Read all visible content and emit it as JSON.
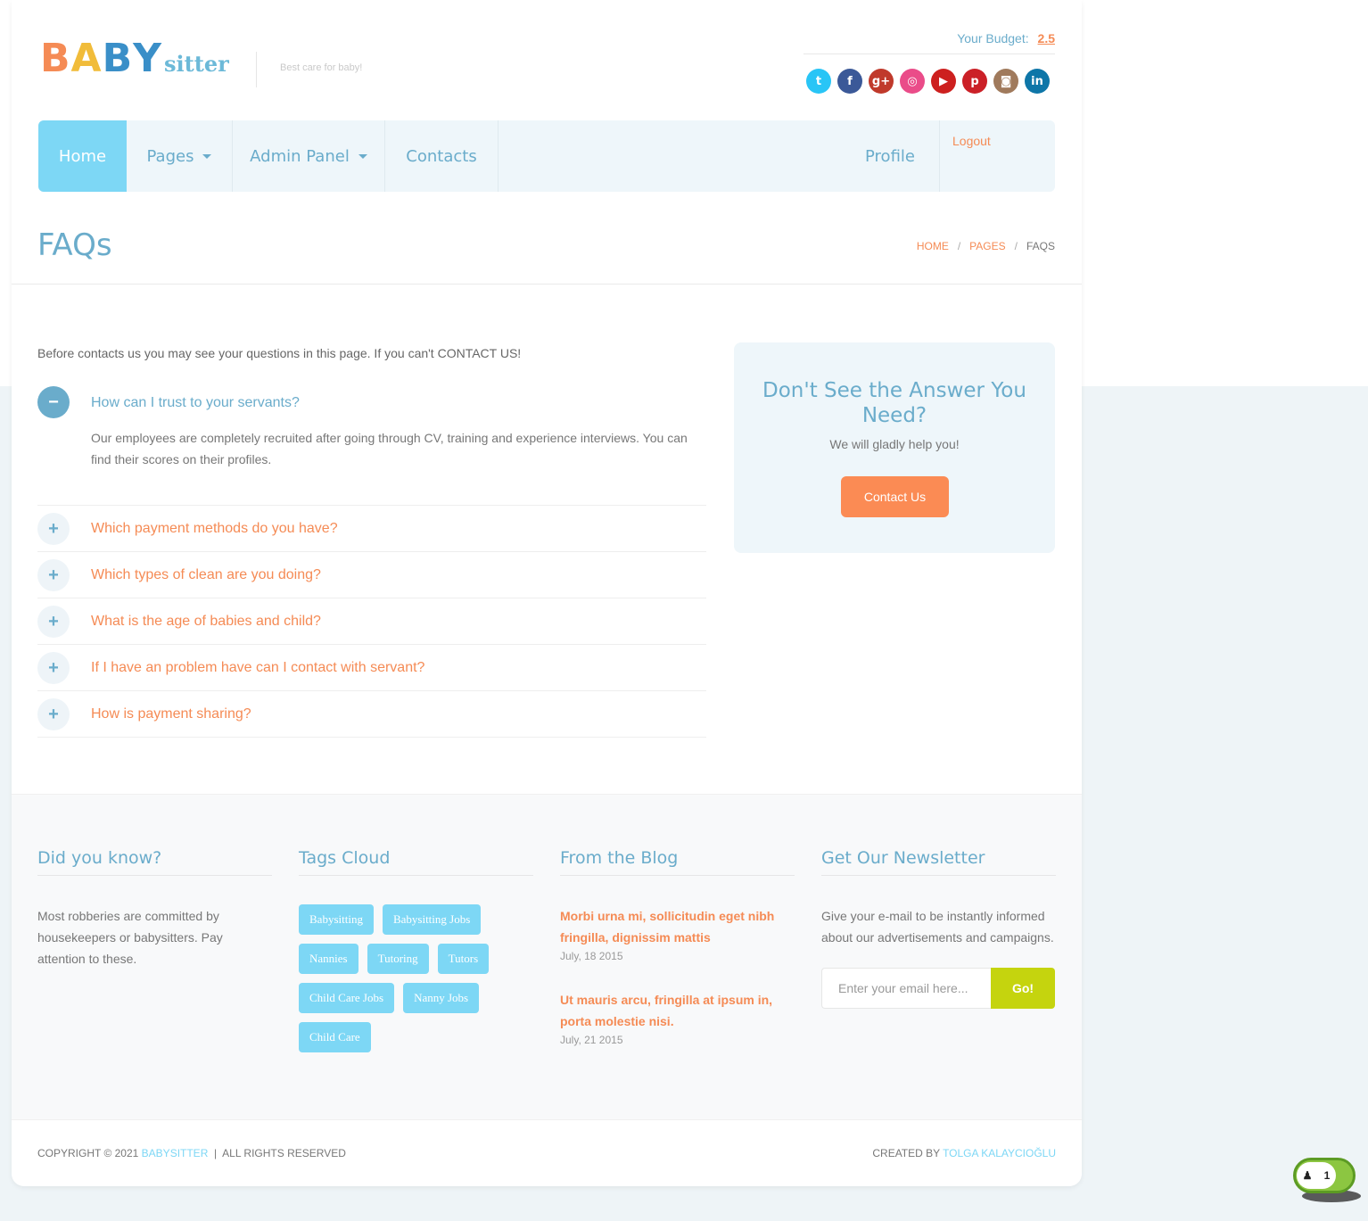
{
  "header": {
    "logo_big": [
      "B",
      "A",
      "B",
      "Y"
    ],
    "logo_small": "sitter",
    "tagline": "Best care for baby!",
    "budget_label": "Your Budget:",
    "budget_value": "2.5",
    "socials": [
      {
        "name": "twitter-icon",
        "glyph": "t",
        "color": "#29c5f6"
      },
      {
        "name": "facebook-icon",
        "glyph": "f",
        "color": "#3b5998"
      },
      {
        "name": "google-plus-icon",
        "glyph": "g+",
        "color": "#c0392b"
      },
      {
        "name": "dribbble-icon",
        "glyph": "◎",
        "color": "#ea4c89"
      },
      {
        "name": "youtube-icon",
        "glyph": "▶",
        "color": "#cd201f"
      },
      {
        "name": "pinterest-icon",
        "glyph": "p",
        "color": "#cb2027"
      },
      {
        "name": "instagram-icon",
        "glyph": "◙",
        "color": "#a07a5c"
      },
      {
        "name": "linkedin-icon",
        "glyph": "in",
        "color": "#0e76a8"
      }
    ]
  },
  "nav": {
    "home": "Home",
    "pages": "Pages",
    "admin": "Admin Panel",
    "contacts": "Contacts",
    "profile": "Profile",
    "logout": "Logout"
  },
  "page": {
    "title": "FAQs",
    "breadcrumb": [
      "HOME",
      "/",
      "PAGES",
      "/",
      "FAQS"
    ]
  },
  "faq": {
    "intro": "Before contacts us you may see your questions in this page. If you can't CONTACT US!",
    "open": {
      "question": "How can I trust to your servants?",
      "answer": "Our employees are completely recruited after going through CV, training and experience interviews. You can find their scores on their profiles.",
      "toggle": "−"
    },
    "items": [
      {
        "question": "Which payment methods do you have?",
        "toggle": "+"
      },
      {
        "question": "Which types of clean are you doing?",
        "toggle": "+"
      },
      {
        "question": "What is the age of babies and child?",
        "toggle": "+"
      },
      {
        "question": "If I have an problem have can I contact with servant?",
        "toggle": "+"
      },
      {
        "question": "How is payment sharing?",
        "toggle": "+"
      }
    ]
  },
  "side_box": {
    "title": "Don't See the Answer You Need?",
    "subtitle": "We will gladly help you!",
    "button": "Contact Us"
  },
  "footer": {
    "did_you_know": {
      "title": "Did you know?",
      "text": "Most robberies are committed by housekeepers or babysitters. Pay attention to these."
    },
    "tags": {
      "title": "Tags Cloud",
      "items": [
        "Babysitting",
        "Babysitting Jobs",
        "Nannies",
        "Tutoring",
        "Tutors",
        "Child Care Jobs",
        "Nanny Jobs",
        "Child Care"
      ]
    },
    "blog": {
      "title": "From the Blog",
      "posts": [
        {
          "title": "Morbi urna mi, sollicitudin eget nibh fringilla, dignissim mattis",
          "date": "July, 18 2015"
        },
        {
          "title": "Ut mauris arcu, fringilla at ipsum in, porta molestie nisi.",
          "date": "July, 21 2015"
        }
      ]
    },
    "newsletter": {
      "title": "Get Our Newsletter",
      "text": "Give your e-mail to be instantly informed about our advertisements and campaigns.",
      "placeholder": "Enter your email here...",
      "button": "Go!"
    }
  },
  "copyright": {
    "prefix": "COPYRIGHT © 2021",
    "brand": "BABYSITTER",
    "separator": "|",
    "suffix": "ALL RIGHTS RESERVED",
    "created_label": "CREATED BY",
    "author": "TOLGA KALAYCIOĞLU"
  },
  "chat_widget": {
    "count": "1"
  }
}
